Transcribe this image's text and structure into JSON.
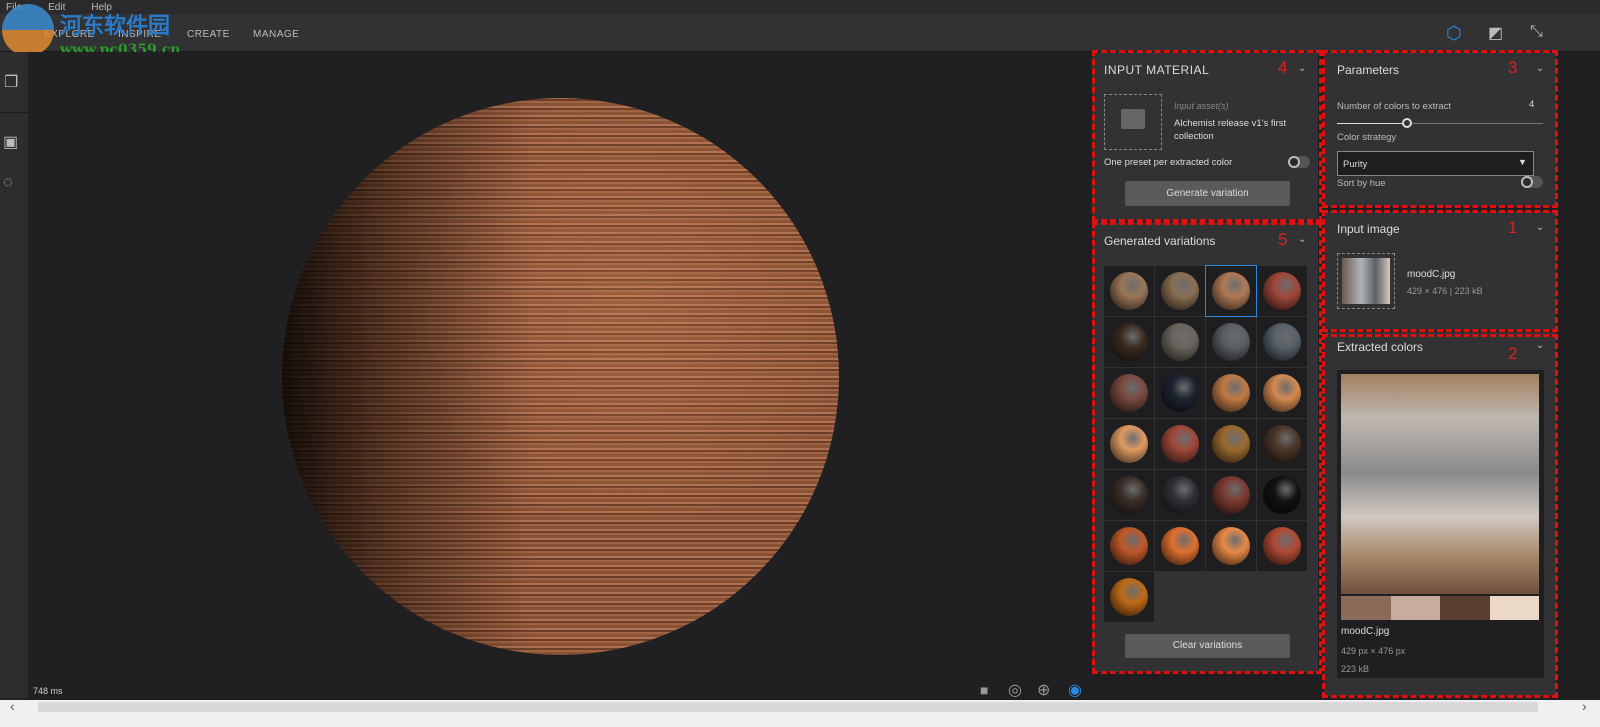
{
  "menu": [
    "File",
    "Edit",
    "Help"
  ],
  "nav": [
    "EXPLORE",
    "INSPIRE",
    "CREATE",
    "MANAGE"
  ],
  "watermark": {
    "title": "河东软件园",
    "url": "www.pc0359.cn"
  },
  "viewport": {
    "render_time": "748 ms"
  },
  "input_material": {
    "title": "INPUT MATERIAL",
    "marker": "4",
    "asset_label": "Input asset(s)",
    "asset_name": "Alchemist release v1's first collection",
    "toggle_label": "One preset per extracted color",
    "toggle_on": false,
    "button": "Generate variation"
  },
  "variations": {
    "title": "Generated variations",
    "marker": "5",
    "button": "Clear variations",
    "selected_index": 2,
    "colors": [
      "#9a7656",
      "#8a6e52",
      "#b07a55",
      "#a0473a",
      "#3a2a20",
      "#6a645c",
      "#5a5e62",
      "#56606a",
      "#7a4a40",
      "#1c2430",
      "#c07a45",
      "#d48a52",
      "#e09a62",
      "#a0483a",
      "#9a6a30",
      "#4a3628",
      "#3a2e28",
      "#2e3034",
      "#7a3a30",
      "#101214",
      "#c0582a",
      "#e0702e",
      "#e88a48",
      "#b04a34",
      "#c06a18"
    ]
  },
  "parameters": {
    "title": "Parameters",
    "marker": "3",
    "colors_label": "Number of colors to extract",
    "colors_value": "4",
    "slider_fraction": 0.34,
    "strategy_label": "Color strategy",
    "strategy_value": "Purity",
    "sort_label": "Sort by hue",
    "sort_on": false
  },
  "input_image": {
    "title": "Input image",
    "marker": "1",
    "filename": "moodC.jpg",
    "meta": "429 × 476 | 223 kB"
  },
  "extracted": {
    "title": "Extracted colors",
    "marker": "2",
    "filename": "moodC.jpg",
    "dimensions": "429 px × 476 px",
    "size": "223 kB",
    "swatches": [
      "#8a6a58",
      "#c8ad9e",
      "#5a3e30",
      "#ecd8c6"
    ]
  },
  "accent": "#2b8ae0"
}
